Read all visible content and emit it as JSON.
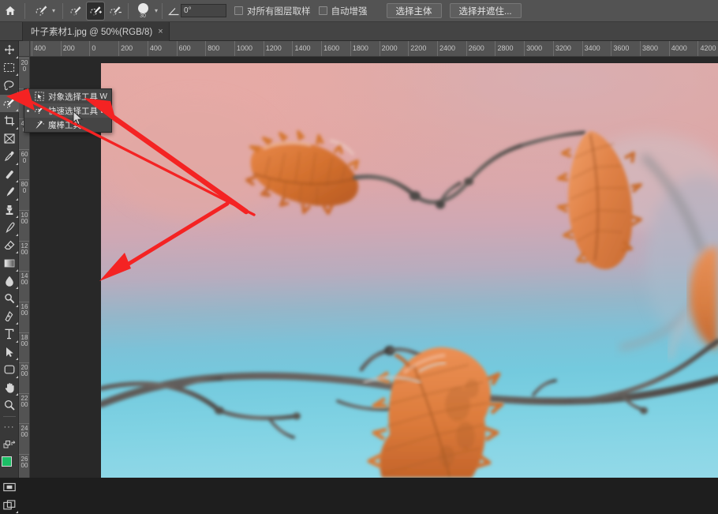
{
  "app": {
    "name": "Adobe Photoshop",
    "home_icon": "home-icon"
  },
  "options_bar": {
    "tool_preset_icon": "quick-selection-preset-icon",
    "mode_buttons": [
      {
        "name": "new-selection",
        "icon": "brush-new-icon",
        "active": false
      },
      {
        "name": "add-to-selection",
        "icon": "brush-add-icon",
        "active": true
      },
      {
        "name": "subtract-from-selection",
        "icon": "brush-subtract-icon",
        "active": false
      }
    ],
    "brush_size": "30",
    "angle_icon": "angle-icon",
    "angle_value": "0°",
    "checkboxes": [
      {
        "label": "对所有图层取样",
        "checked": false
      },
      {
        "label": "自动增强",
        "checked": false
      }
    ],
    "buttons": [
      {
        "label": "选择主体"
      },
      {
        "label": "选择并遮住..."
      }
    ]
  },
  "tab": {
    "title": "叶子素材1.jpg @ 50%(RGB/8)",
    "close": "×"
  },
  "toolbar": {
    "tools": [
      {
        "name": "move-tool",
        "icon": "move-icon",
        "selected": false,
        "has_flyout": true
      },
      {
        "name": "rectangular-marquee",
        "icon": "marquee-icon",
        "selected": false,
        "has_flyout": true
      },
      {
        "name": "lasso-tool",
        "icon": "lasso-icon",
        "selected": false,
        "has_flyout": true
      },
      {
        "name": "quick-selection-tool",
        "icon": "quick-selection-icon",
        "selected": true,
        "has_flyout": true
      },
      {
        "name": "crop-tool",
        "icon": "crop-icon",
        "selected": false,
        "has_flyout": true
      },
      {
        "name": "frame-tool",
        "icon": "frame-icon",
        "selected": false,
        "has_flyout": false
      },
      {
        "name": "eyedropper-tool",
        "icon": "eyedropper-icon",
        "selected": false,
        "has_flyout": true
      },
      {
        "name": "healing-brush-tool",
        "icon": "healing-brush-icon",
        "selected": false,
        "has_flyout": true
      },
      {
        "name": "brush-tool",
        "icon": "brush-icon",
        "selected": false,
        "has_flyout": true
      },
      {
        "name": "clone-stamp-tool",
        "icon": "clone-stamp-icon",
        "selected": false,
        "has_flyout": true
      },
      {
        "name": "history-brush-tool",
        "icon": "history-brush-icon",
        "selected": false,
        "has_flyout": true
      },
      {
        "name": "eraser-tool",
        "icon": "eraser-icon",
        "selected": false,
        "has_flyout": true
      },
      {
        "name": "gradient-tool",
        "icon": "gradient-icon",
        "selected": false,
        "has_flyout": true
      },
      {
        "name": "blur-tool",
        "icon": "blur-icon",
        "selected": false,
        "has_flyout": true
      },
      {
        "name": "dodge-tool",
        "icon": "dodge-icon",
        "selected": false,
        "has_flyout": true
      },
      {
        "name": "pen-tool",
        "icon": "pen-icon",
        "selected": false,
        "has_flyout": true
      },
      {
        "name": "type-tool",
        "icon": "type-icon",
        "selected": false,
        "has_flyout": true
      },
      {
        "name": "path-selection-tool",
        "icon": "path-selection-icon",
        "selected": false,
        "has_flyout": true
      },
      {
        "name": "rectangle-tool",
        "icon": "rectangle-shape-icon",
        "selected": false,
        "has_flyout": true
      },
      {
        "name": "hand-tool",
        "icon": "hand-icon",
        "selected": false,
        "has_flyout": true
      },
      {
        "name": "zoom-tool",
        "icon": "zoom-icon",
        "selected": false,
        "has_flyout": false
      }
    ],
    "more_tools": "···",
    "foreground_color": "#1cbf66",
    "background_color": "#ffffff",
    "quick_mask_icon": "quick-mask-icon",
    "screen_mode_icon": "screen-mode-icon"
  },
  "flyout_menu": {
    "items": [
      {
        "label": "对象选择工具",
        "shortcut": "W",
        "icon": "object-selection-icon",
        "current": false
      },
      {
        "label": "快速选择工具",
        "shortcut": "W",
        "icon": "quick-selection-icon",
        "current": true
      },
      {
        "label": "魔棒工具",
        "shortcut": "",
        "icon": "magic-wand-icon",
        "current": false
      }
    ]
  },
  "rulers": {
    "unit": "px",
    "horizontal_labels": [
      "400",
      "200",
      "0",
      "200",
      "400",
      "600",
      "800",
      "1000",
      "1200",
      "1400",
      "1600",
      "1800",
      "2000",
      "2200",
      "2400",
      "2600",
      "2800",
      "3000",
      "3200",
      "3400",
      "3600",
      "3800",
      "4000",
      "4200"
    ],
    "vertical_labels": [
      "200",
      "0",
      "400",
      "600",
      "800",
      "1000",
      "1200",
      "1400",
      "1600",
      "1800",
      "2000",
      "2200",
      "2400",
      "2600"
    ]
  },
  "annotations": {
    "arrow_color": "#f42323",
    "arrows": [
      {
        "name": "arrow-to-quick-selection-tool",
        "desc": "points at quick selection tool in toolbar"
      },
      {
        "name": "arrow-to-flyout-item",
        "desc": "points at 快速选择工具 menu entry"
      }
    ],
    "cursor_icon": "mouse-pointer-icon"
  },
  "document": {
    "image_description": "blurred autumn oak leaves on branches against pink-to-cyan gradient sky",
    "zoom": "50%",
    "color_mode": "RGB/8"
  }
}
